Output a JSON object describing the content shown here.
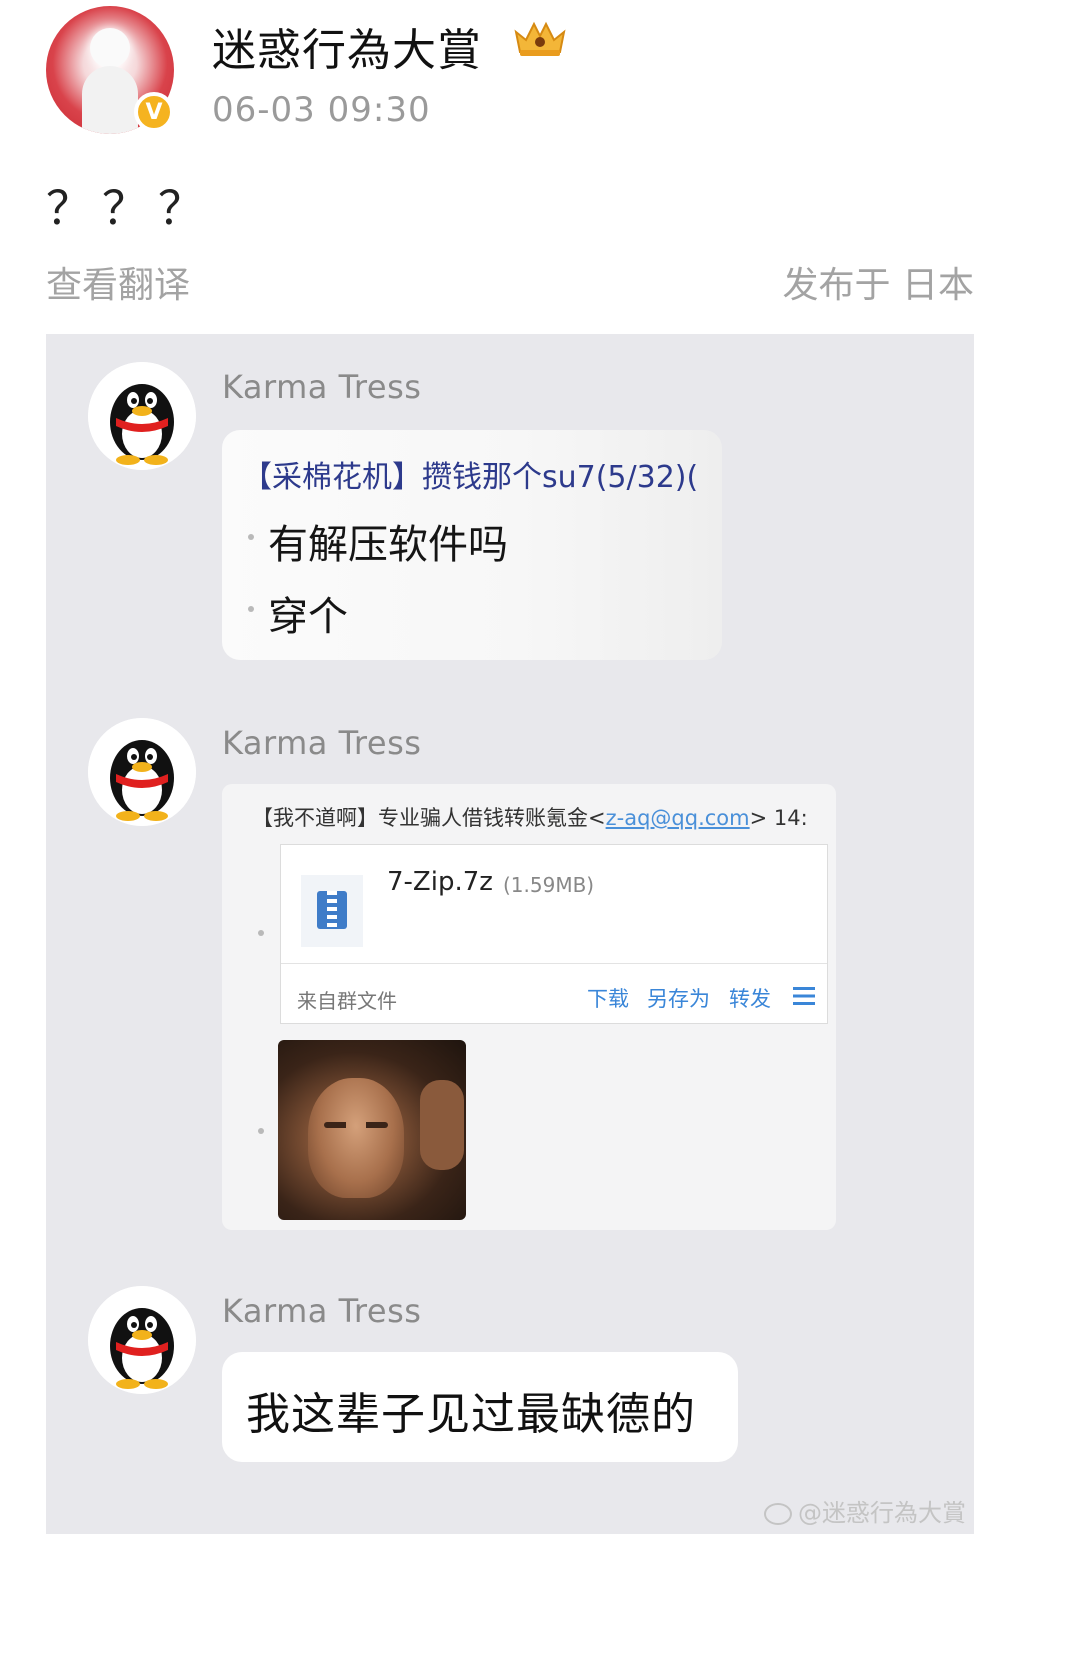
{
  "post": {
    "username": "迷惑行為大賞",
    "verified_badge": "V",
    "timestamp": "06-03 09:30",
    "text": "？？？",
    "translate_label": "查看翻译",
    "location_label": "发布于 日本"
  },
  "chat": {
    "messages": [
      {
        "sender": "Karma Tress",
        "reference": "【采棉花机】攒钱那个su7(5/32)(",
        "lines": [
          "有解压软件吗",
          "穿个"
        ]
      },
      {
        "sender": "Karma Tress",
        "reference_prefix": "【我不道啊】专业骗人借钱转账氪金<",
        "reference_email": "z-aq@qq.com",
        "reference_suffix": ">  14:",
        "file": {
          "name": "7-Zip.7z",
          "size": "(1.59MB)",
          "source": "来自群文件",
          "actions": [
            "下载",
            "另存为",
            "转发"
          ]
        }
      },
      {
        "sender": "Karma Tress",
        "text": "我这辈子见过最缺德的"
      }
    ]
  },
  "watermark": "@迷惑行為大賞",
  "icons": {
    "crown": "crown-icon",
    "qq_avatar": "qq-penguin-icon",
    "file": "zip-file-icon",
    "menu": "menu-icon",
    "watermark": "weibo-icon"
  }
}
